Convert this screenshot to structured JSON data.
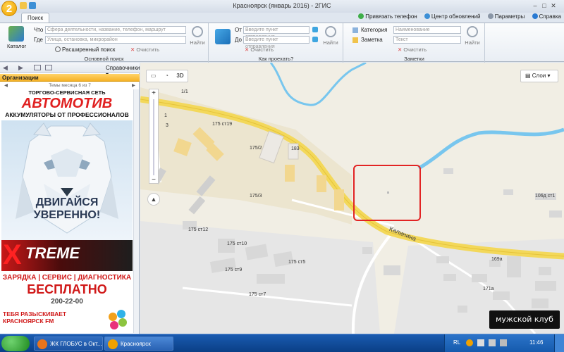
{
  "window": {
    "title": "Красноярск (январь 2016) - 2ГИС",
    "app_logo": "2"
  },
  "ribbon": {
    "tab_label": "Поиск",
    "links": [
      "Привязать телефон",
      "Центр обновлений",
      "Параметры",
      "Справка"
    ],
    "search_group": {
      "catalog_label": "Каталог",
      "what_label": "Что",
      "what_placeholder": "Сфера деятельности, название, телефон, маршрут",
      "where_label": "Где",
      "where_placeholder": "Улица, остановка, микрорайон",
      "find_label": "Найти",
      "advanced_label": "Расширенный поиск",
      "clear_label": "Очистить",
      "group_label": "Основной поиск"
    },
    "route_group": {
      "from_label": "От",
      "from_placeholder": "Введите пункт отправления",
      "to_label": "До",
      "to_placeholder": "Введите пункт отправления",
      "clear_label": "Очистить",
      "find_label": "Найти",
      "group_label": "Как проехать?"
    },
    "notes_group": {
      "category_label": "Категория",
      "category_placeholder": "Наименование",
      "note_label": "Заметка",
      "note_placeholder": "Текст",
      "clear_label": "Очистить",
      "find_label": "Найти",
      "group_label": "Заметки"
    }
  },
  "left_panel": {
    "directories_label": "Справочники",
    "section_title": "Организации",
    "nav_text": "Темы месяца 6 из 7",
    "ad": {
      "network_line": "ТОРГОВО-СЕРВИСНАЯ СЕТЬ",
      "brand": "АВТОМОТИВ",
      "tagline": "АККУМУЛЯТОРЫ ОТ ПРОФЕССИОНАЛОВ",
      "slogan_1": "ДВИГАЙСЯ",
      "slogan_2": "УВЕРЕННО!",
      "product": "TREME",
      "services": "ЗАРЯДКА | СЕРВИС | ДИАГНОСТИКА",
      "free": "БЕСПЛАТНО",
      "phone": "200-22-00",
      "radio": "ТЕБЯ РАЗЫСКИВАЕТ КРАСНОЯРСК FM"
    }
  },
  "map": {
    "tool_3d": "3D",
    "layers_label": "Слои",
    "street_label": "Калинина",
    "brand_badge": "мужской клуб",
    "labels": {
      "b_1_1": "1/1",
      "b_1": "1",
      "b_3": "3",
      "b_175c19": "175 ст19",
      "b_175_2": "175/2",
      "b_183": "183",
      "b_175_3": "175/3",
      "b_175c12": "175 ст12",
      "b_175c10": "175 ст10",
      "b_175c5": "175 ст5",
      "b_175c9": "175 ст9",
      "b_175c7": "175 ст7",
      "b_106d": "106д ст1",
      "b_169a": "169а",
      "b_171a": "171а"
    }
  },
  "taskbar": {
    "tasks": [
      "ЖК ГЛОБУС в Окт...",
      "Красноярск (январ..."
    ],
    "tray_lang": "RL",
    "clock": "11:46"
  }
}
